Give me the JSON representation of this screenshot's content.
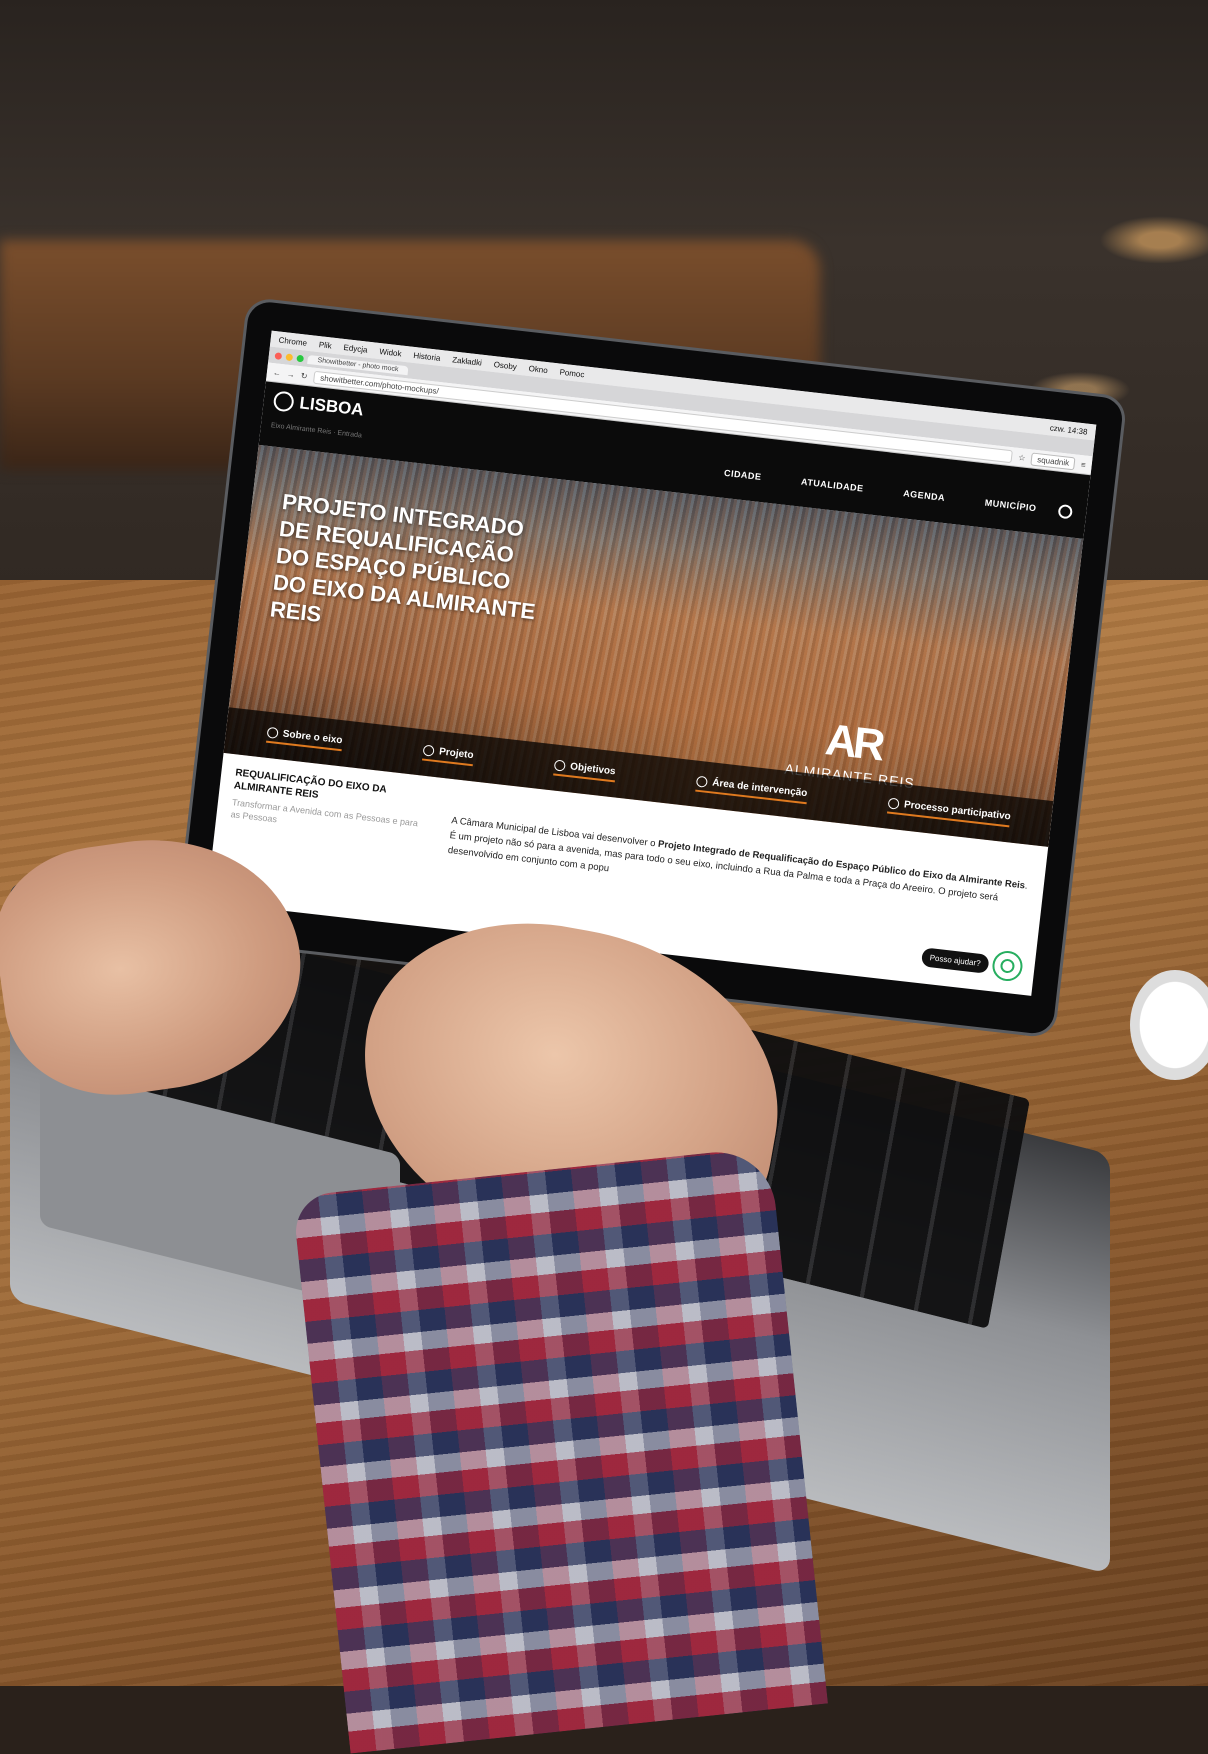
{
  "browser": {
    "menu": [
      "Chrome",
      "Plik",
      "Edycja",
      "Widok",
      "Historia",
      "Zakładki",
      "Osoby",
      "Okno",
      "Pomoc"
    ],
    "clock": "czw. 14:38",
    "tab_title": "Showitbetter - photo mock",
    "url": "showitbetter.com/photo-mockups/",
    "profile": "squadnik"
  },
  "site": {
    "logo": "LISBOA",
    "breadcrumbs": "Eixo Almirante Reis · Entrada",
    "nav": [
      "CIDADE",
      "ATUALIDADE",
      "AGENDA",
      "MUNICÍPIO"
    ]
  },
  "hero": {
    "title": "PROJETO INTEGRADO DE REQUALIFICAÇÃO DO ESPAÇO PÚBLICO DO EIXO DA ALMIRANTE REIS",
    "logo_big": "AR",
    "logo_small": "ALMIRANTE REIS",
    "tabs": [
      {
        "label": "Sobre o eixo",
        "icon": "clock-icon"
      },
      {
        "label": "Projeto",
        "icon": "half-circle-icon"
      },
      {
        "label": "Objetivos",
        "icon": "check-circle-icon"
      },
      {
        "label": "Área de intervenção",
        "icon": "target-icon"
      },
      {
        "label": "Processo participativo",
        "icon": "triangle-circle-icon"
      }
    ]
  },
  "content": {
    "title": "REQUALIFICAÇÃO DO EIXO DA ALMIRANTE REIS",
    "subtitle": "Transformar a Avenida com as Pessoas e para as Pessoas",
    "body_1": "A Câmara Municipal de Lisboa vai desenvolver o ",
    "body_bold": "Projeto Integrado de Requalificação do Espaço Público do Eixo da Almirante Reis",
    "body_2": ". É um projeto não só para a avenida, mas para todo o seu eixo, incluindo a Rua da Palma e toda a Praça do Areeiro. O projeto será desenvolvido em conjunto com a popu"
  },
  "help": {
    "label": "Posso ajudar?"
  },
  "colors": {
    "accent": "#e07a1f",
    "help_green": "#27ae60",
    "header_bg": "#0b0b0b"
  }
}
